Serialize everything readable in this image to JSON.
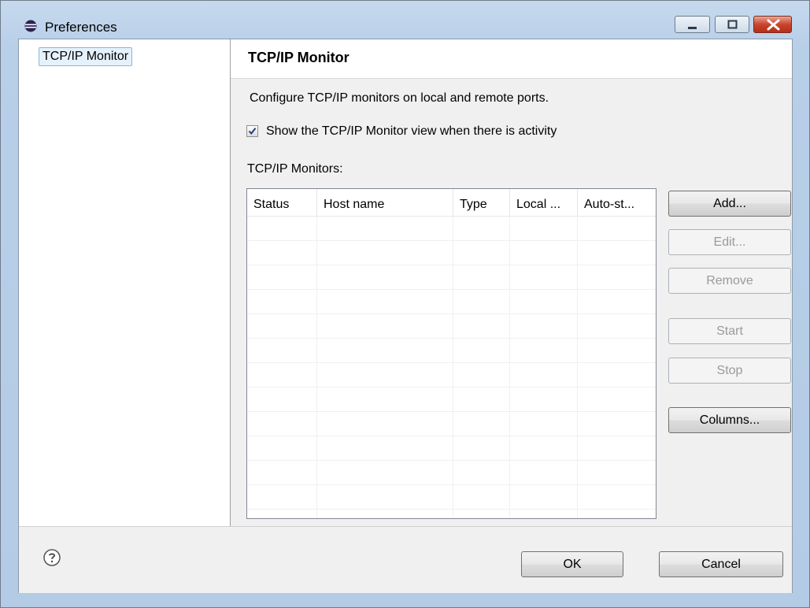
{
  "window": {
    "title": "Preferences"
  },
  "tree": {
    "items": [
      {
        "label": "TCP/IP Monitor"
      }
    ]
  },
  "page": {
    "title": "TCP/IP Monitor",
    "description": "Configure TCP/IP monitors on local and remote ports.",
    "show_view_checkbox": {
      "label": "Show the TCP/IP Monitor view when there is activity",
      "checked": true
    },
    "monitors_label": "TCP/IP Monitors:",
    "table": {
      "columns": [
        "Status",
        "Host name",
        "Type",
        "Local ...",
        "Auto-st..."
      ],
      "rows": []
    },
    "buttons": {
      "add": "Add...",
      "edit": "Edit...",
      "remove": "Remove",
      "start": "Start",
      "stop": "Stop",
      "columns": "Columns..."
    }
  },
  "footer": {
    "ok": "OK",
    "cancel": "Cancel",
    "help_icon": "help-icon"
  },
  "colors": {
    "title_bar": "#b9d1ea",
    "close_button": "#c9442c",
    "selection": "#e5f1fb"
  }
}
